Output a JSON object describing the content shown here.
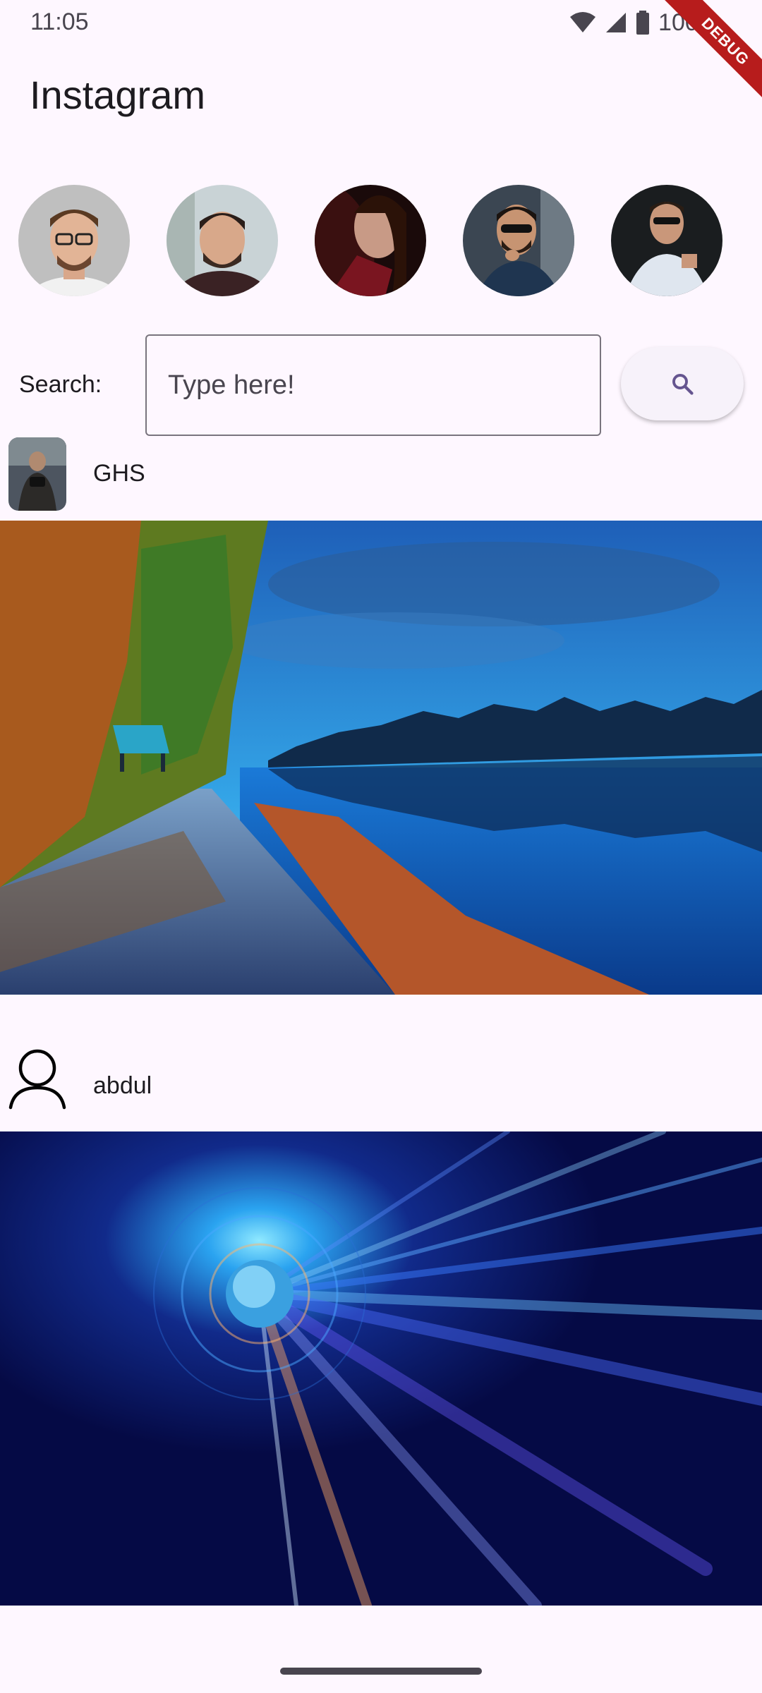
{
  "status_bar": {
    "time": "11:05",
    "battery": "100%"
  },
  "debug_banner": "DEBUG",
  "app_bar": {
    "title": "Instagram"
  },
  "stories": [
    {
      "name": "story-1"
    },
    {
      "name": "story-2"
    },
    {
      "name": "story-3"
    },
    {
      "name": "story-4"
    },
    {
      "name": "story-5"
    }
  ],
  "search": {
    "label": "Search:",
    "placeholder": "Type here!",
    "button_icon": "search-icon"
  },
  "posts": [
    {
      "username": "GHS",
      "avatar": "photo-avatar",
      "image": "autumn lake landscape"
    },
    {
      "username": "abdul",
      "avatar": "person-outline-icon",
      "image": "abstract blue fractal"
    }
  ],
  "colors": {
    "background": "#fef7ff",
    "accent": "#65558f",
    "outline": "#79747e"
  }
}
